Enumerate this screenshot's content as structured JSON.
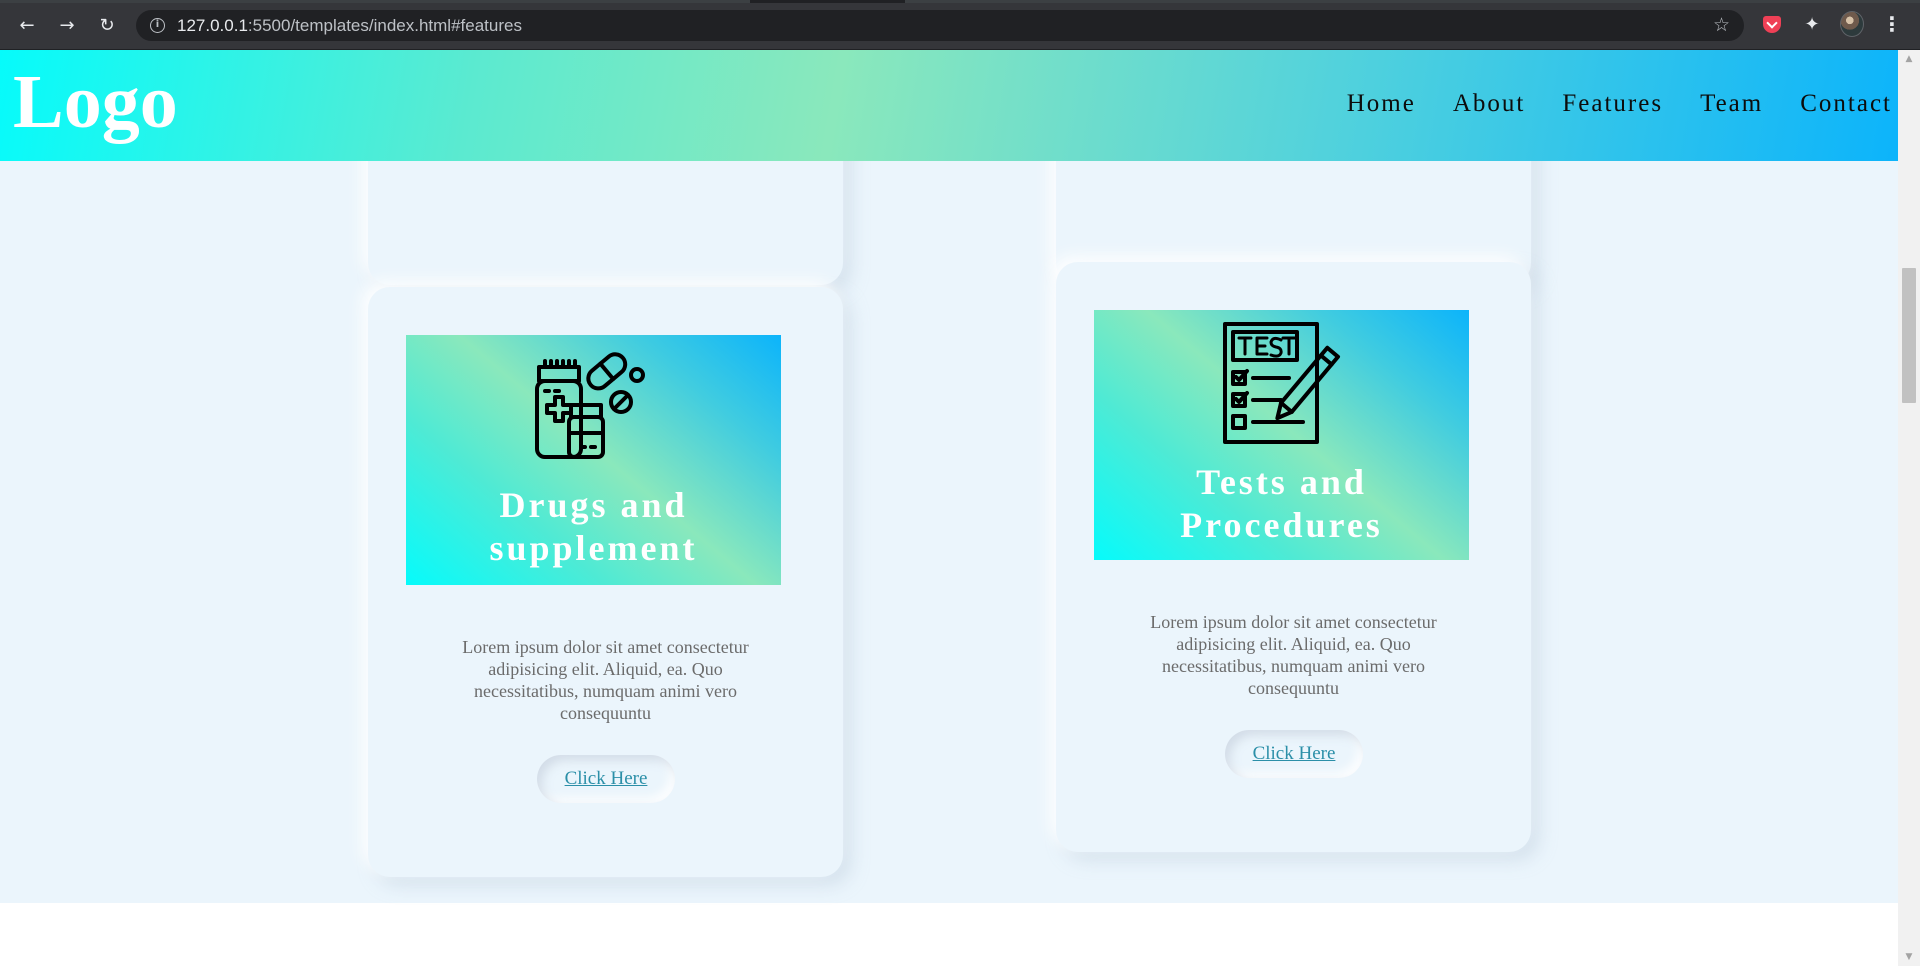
{
  "browser": {
    "url_host": "127.0.0.1",
    "url_rest": ":5500/templates/index.html#features",
    "icons": [
      "back-arrow-icon",
      "forward-arrow-icon",
      "reload-icon",
      "info-icon",
      "star-icon",
      "pocket-icon",
      "puzzle-icon",
      "avatar",
      "menu-icon"
    ]
  },
  "header": {
    "logo": "Logo",
    "nav": [
      "Home",
      "About",
      "Features",
      "Team",
      "Contact"
    ]
  },
  "cards": [
    {
      "title": "Drugs and supplement",
      "icon": "medicine-bottles-icon",
      "text": "Lorem ipsum dolor sit amet consectetur adipisicing elit. Aliquid, ea. Quo necessitatibus, numquam animi vero consequuntu",
      "button": "Click Here"
    },
    {
      "title": "Tests and Procedures",
      "icon": "test-checklist-icon",
      "text": "Lorem ipsum dolor sit amet consectetur adipisicing elit. Aliquid, ea. Quo necessitatibus, numquam animi vero consequuntu",
      "button": "Click Here"
    }
  ],
  "colors": {
    "page_bg": "#ebf5fc",
    "gradient_start": "#06fbfb",
    "gradient_mid": "#8ae8bc",
    "gradient_end": "#0cb4fb",
    "link": "#2b8fa8"
  }
}
